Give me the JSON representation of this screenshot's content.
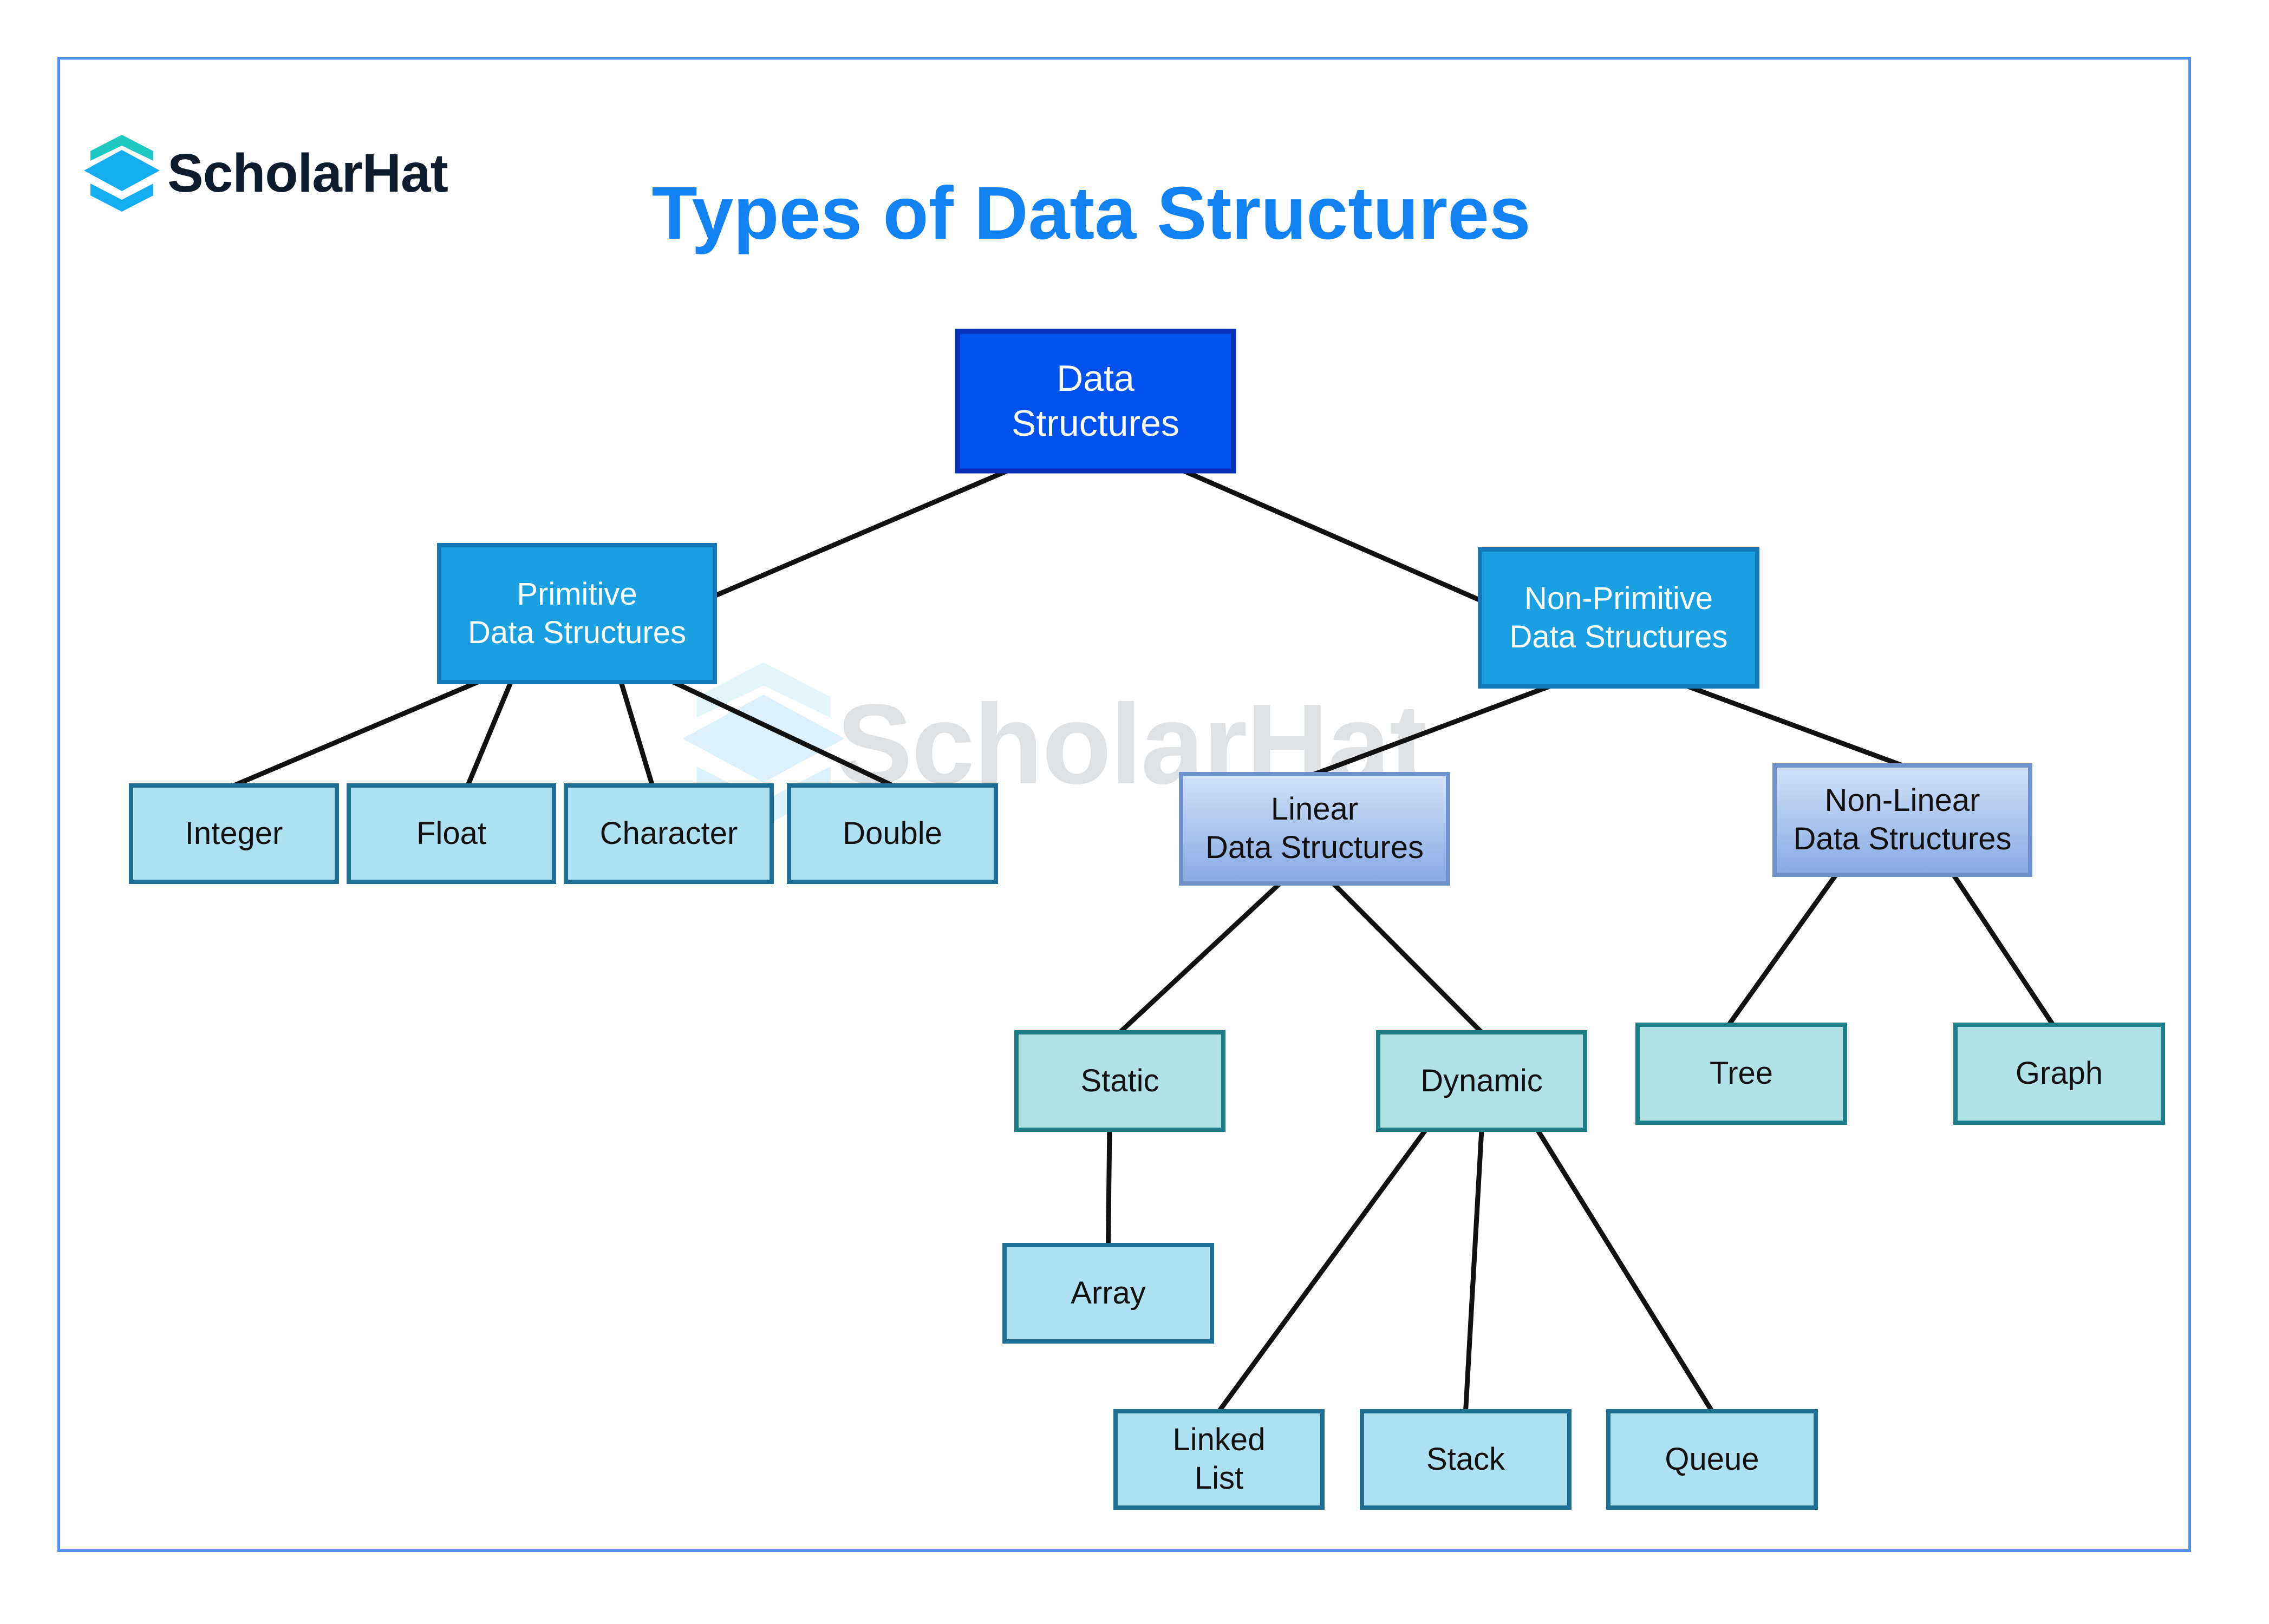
{
  "brand": {
    "name": "ScholarHat",
    "logo_icon": "stacked-layers-icon",
    "colors": {
      "top_layer": "#1ec9c2",
      "bottom_layers": "#14adf2",
      "text": "#0d1b2a"
    }
  },
  "title": "Types of Data Structures",
  "title_color": "#1281f2",
  "frame_color": "#4d8ef7",
  "watermark": {
    "text": "ScholarHat"
  },
  "styles": {
    "root": {
      "fill": "#0051ee",
      "stroke": "#0a2fb8",
      "text": "#ffffff"
    },
    "category": {
      "fill": "#1a9fe0",
      "stroke": "#1478b8",
      "text": "#ffffff"
    },
    "subcategory": {
      "fill_top": "#d2e2fa",
      "fill_bottom": "#86aae2",
      "stroke": "#7092cc",
      "text": "#111111"
    },
    "teal": {
      "fill": "#afe1e5",
      "stroke": "#1f7f88",
      "text": "#111111"
    },
    "leaf": {
      "fill": "#ade0f1",
      "stroke": "#1e6f94",
      "text": "#111111"
    },
    "connector": "#111111"
  },
  "nodes": [
    {
      "id": "root",
      "label": "Data\nStructures",
      "style": "root"
    },
    {
      "id": "primitive",
      "label": "Primitive\nData Structures",
      "style": "category"
    },
    {
      "id": "non_primitive",
      "label": "Non-Primitive\nData Structures",
      "style": "category"
    },
    {
      "id": "integer",
      "label": "Integer",
      "style": "leaf"
    },
    {
      "id": "float",
      "label": "Float",
      "style": "leaf"
    },
    {
      "id": "character",
      "label": "Character",
      "style": "leaf"
    },
    {
      "id": "double",
      "label": "Double",
      "style": "leaf"
    },
    {
      "id": "linear",
      "label": "Linear\nData Structures",
      "style": "subcategory"
    },
    {
      "id": "non_linear",
      "label": "Non-Linear\nData Structures",
      "style": "subcategory"
    },
    {
      "id": "static",
      "label": "Static",
      "style": "teal"
    },
    {
      "id": "dynamic",
      "label": "Dynamic",
      "style": "teal"
    },
    {
      "id": "tree",
      "label": "Tree",
      "style": "teal"
    },
    {
      "id": "graph",
      "label": "Graph",
      "style": "teal"
    },
    {
      "id": "array",
      "label": "Array",
      "style": "leaf"
    },
    {
      "id": "linked_list",
      "label": "Linked\nList",
      "style": "leaf"
    },
    {
      "id": "stack",
      "label": "Stack",
      "style": "leaf"
    },
    {
      "id": "queue",
      "label": "Queue",
      "style": "leaf"
    }
  ],
  "edges": [
    [
      "root",
      "primitive"
    ],
    [
      "root",
      "non_primitive"
    ],
    [
      "primitive",
      "integer"
    ],
    [
      "primitive",
      "float"
    ],
    [
      "primitive",
      "character"
    ],
    [
      "primitive",
      "double"
    ],
    [
      "non_primitive",
      "linear"
    ],
    [
      "non_primitive",
      "non_linear"
    ],
    [
      "linear",
      "static"
    ],
    [
      "linear",
      "dynamic"
    ],
    [
      "non_linear",
      "tree"
    ],
    [
      "non_linear",
      "graph"
    ],
    [
      "static",
      "array"
    ],
    [
      "dynamic",
      "linked_list"
    ],
    [
      "dynamic",
      "stack"
    ],
    [
      "dynamic",
      "queue"
    ]
  ]
}
